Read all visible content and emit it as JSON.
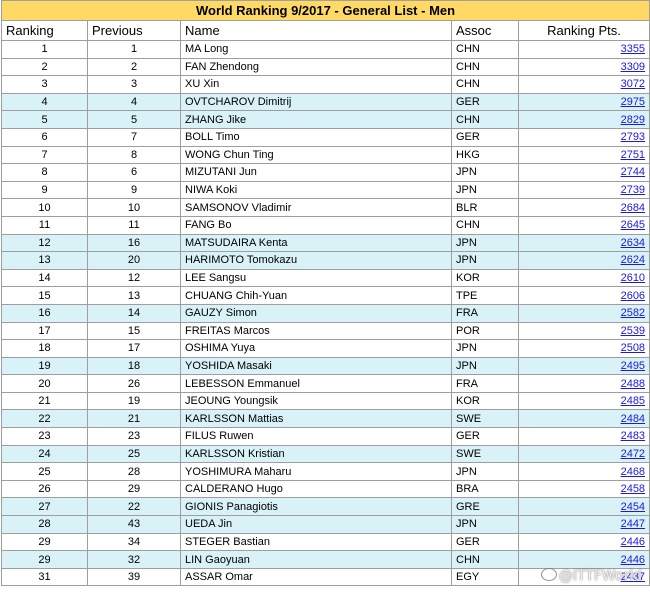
{
  "title": "World Ranking 9/2017 - General List - Men",
  "headers": {
    "ranking": "Ranking",
    "previous": "Previous",
    "name": "Name",
    "assoc": "Assoc",
    "points": "Ranking Pts."
  },
  "rows": [
    {
      "rank": "1",
      "prev": "1",
      "name": "MA Long",
      "assoc": "CHN",
      "pts": "3355"
    },
    {
      "rank": "2",
      "prev": "2",
      "name": "FAN Zhendong",
      "assoc": "CHN",
      "pts": "3309"
    },
    {
      "rank": "3",
      "prev": "3",
      "name": "XU Xin",
      "assoc": "CHN",
      "pts": "3072"
    },
    {
      "rank": "4",
      "prev": "4",
      "name": "OVTCHAROV Dimitrij",
      "assoc": "GER",
      "pts": "2975"
    },
    {
      "rank": "5",
      "prev": "5",
      "name": "ZHANG Jike",
      "assoc": "CHN",
      "pts": "2829"
    },
    {
      "rank": "6",
      "prev": "7",
      "name": "BOLL Timo",
      "assoc": "GER",
      "pts": "2793"
    },
    {
      "rank": "7",
      "prev": "8",
      "name": "WONG Chun Ting",
      "assoc": "HKG",
      "pts": "2751"
    },
    {
      "rank": "8",
      "prev": "6",
      "name": "MIZUTANI Jun",
      "assoc": "JPN",
      "pts": "2744"
    },
    {
      "rank": "9",
      "prev": "9",
      "name": "NIWA Koki",
      "assoc": "JPN",
      "pts": "2739"
    },
    {
      "rank": "10",
      "prev": "10",
      "name": "SAMSONOV Vladimir",
      "assoc": "BLR",
      "pts": "2684"
    },
    {
      "rank": "11",
      "prev": "11",
      "name": "FANG Bo",
      "assoc": "CHN",
      "pts": "2645"
    },
    {
      "rank": "12",
      "prev": "16",
      "name": "MATSUDAIRA Kenta",
      "assoc": "JPN",
      "pts": "2634"
    },
    {
      "rank": "13",
      "prev": "20",
      "name": "HARIMOTO Tomokazu",
      "assoc": "JPN",
      "pts": "2624"
    },
    {
      "rank": "14",
      "prev": "12",
      "name": "LEE Sangsu",
      "assoc": "KOR",
      "pts": "2610"
    },
    {
      "rank": "15",
      "prev": "13",
      "name": "CHUANG Chih-Yuan",
      "assoc": "TPE",
      "pts": "2606"
    },
    {
      "rank": "16",
      "prev": "14",
      "name": "GAUZY Simon",
      "assoc": "FRA",
      "pts": "2582"
    },
    {
      "rank": "17",
      "prev": "15",
      "name": "FREITAS Marcos",
      "assoc": "POR",
      "pts": "2539"
    },
    {
      "rank": "18",
      "prev": "17",
      "name": "OSHIMA Yuya",
      "assoc": "JPN",
      "pts": "2508"
    },
    {
      "rank": "19",
      "prev": "18",
      "name": "YOSHIDA Masaki",
      "assoc": "JPN",
      "pts": "2495"
    },
    {
      "rank": "20",
      "prev": "26",
      "name": "LEBESSON Emmanuel",
      "assoc": "FRA",
      "pts": "2488"
    },
    {
      "rank": "21",
      "prev": "19",
      "name": "JEOUNG Youngsik",
      "assoc": "KOR",
      "pts": "2485"
    },
    {
      "rank": "22",
      "prev": "21",
      "name": "KARLSSON Mattias",
      "assoc": "SWE",
      "pts": "2484"
    },
    {
      "rank": "23",
      "prev": "23",
      "name": "FILUS Ruwen",
      "assoc": "GER",
      "pts": "2483"
    },
    {
      "rank": "24",
      "prev": "25",
      "name": "KARLSSON Kristian",
      "assoc": "SWE",
      "pts": "2472"
    },
    {
      "rank": "25",
      "prev": "28",
      "name": "YOSHIMURA Maharu",
      "assoc": "JPN",
      "pts": "2468"
    },
    {
      "rank": "26",
      "prev": "29",
      "name": "CALDERANO Hugo",
      "assoc": "BRA",
      "pts": "2458"
    },
    {
      "rank": "27",
      "prev": "22",
      "name": "GIONIS Panagiotis",
      "assoc": "GRE",
      "pts": "2454"
    },
    {
      "rank": "28",
      "prev": "43",
      "name": "UEDA Jin",
      "assoc": "JPN",
      "pts": "2447"
    },
    {
      "rank": "29",
      "prev": "34",
      "name": "STEGER Bastian",
      "assoc": "GER",
      "pts": "2446"
    },
    {
      "rank": "29",
      "prev": "32",
      "name": "LIN Gaoyuan",
      "assoc": "CHN",
      "pts": "2446"
    },
    {
      "rank": "31",
      "prev": "39",
      "name": "ASSAR Omar",
      "assoc": "EGY",
      "pts": "2437"
    }
  ],
  "watermark": "@ITTFWorld",
  "colors": {
    "title_bg": "#ffd966",
    "alt_row_bg": "#d9f2f7",
    "link": "#1a1ae0",
    "border": "#9e9e9e"
  }
}
